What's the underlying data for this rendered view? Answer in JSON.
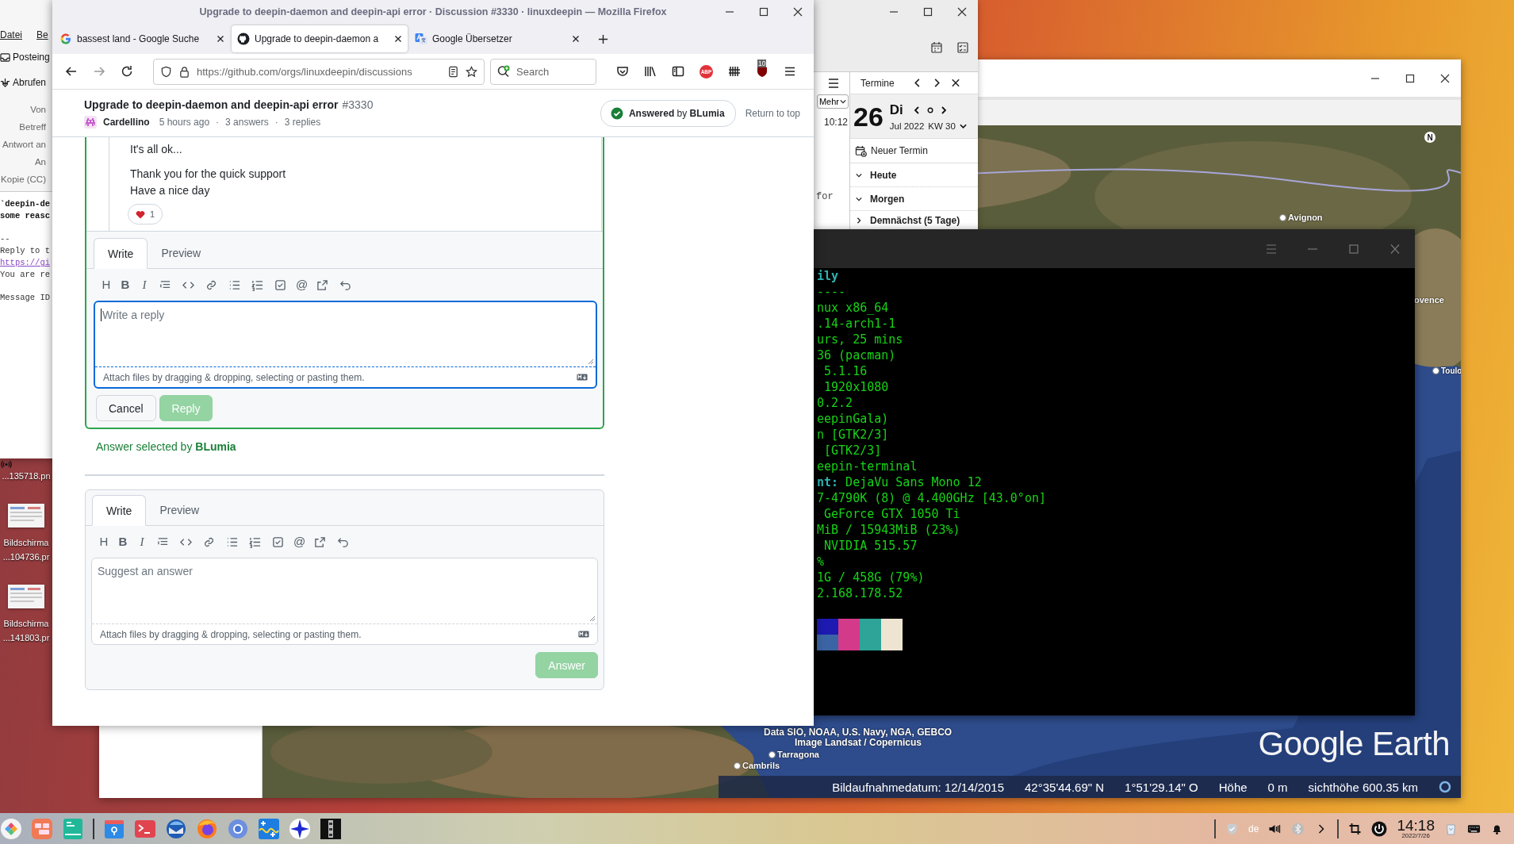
{
  "thunderbird": {
    "menu": [
      "Datei",
      "Be"
    ],
    "toolbar": [
      {
        "kind": "inbox",
        "label": "Posteing"
      },
      {
        "kind": "fetch",
        "label": "Abrufen"
      }
    ],
    "header_fields": [
      "Von",
      "Betreff",
      "Antwort an",
      "An",
      "Kopie (CC)"
    ],
    "body_paragraphs": [
      [
        {
          "kind": "bold",
          "text": "`deepin-de"
        },
        {
          "kind": "bold",
          "text": "some reasc"
        }
      ],
      [
        {
          "kind": "plain",
          "text": "--"
        },
        {
          "kind": "plain",
          "text": "Reply to t"
        },
        {
          "kind": "link",
          "text": "https://gi"
        },
        {
          "kind": "plain",
          "text": "You are re"
        }
      ],
      [
        {
          "kind": "plain",
          "text": "Message ID"
        }
      ]
    ],
    "view_select": "Mehr",
    "message_time": "10:12",
    "message_fragment": "for"
  },
  "today_pane": {
    "title": "Termine",
    "day": "26",
    "weekday": "Di",
    "month": "Jul 2022",
    "week": "KW 30",
    "new_event": "Neuer Termin",
    "groups": [
      {
        "label": "Heute",
        "expanded": true
      },
      {
        "label": "Morgen",
        "expanded": true
      },
      {
        "label": "Demnächst (5 Tage)",
        "expanded": false
      }
    ]
  },
  "firefox": {
    "title": "Upgrade to deepin-daemon and deepin-api error · Discussion #3330 · linuxdeepin — Mozilla Firefox",
    "tabs": [
      {
        "kind": "search",
        "label": "bassest land - Google Suche",
        "selected": false
      },
      {
        "kind": "code",
        "label": "Upgrade to deepin-daemon a",
        "selected": true
      },
      {
        "kind": "translate",
        "label": "Google Übersetzer",
        "selected": false
      }
    ],
    "url": "https://github.com/orgs/linuxdeepin/discussions",
    "search_placeholder": "Search",
    "adblock_label": "ABP",
    "blocker_badge": "10"
  },
  "discussion": {
    "title": "Upgrade to deepin-daemon and deepin-api error",
    "number": "#3330",
    "author": "Cardellino",
    "age": "5 hours ago",
    "answers": "3 answers",
    "replies": "3 replies",
    "separator": "·",
    "answered_by": "**Answered** by **BLumia**",
    "return_to_top": "Return to top",
    "comment_paragraphs": [
      [
        "It's all ok..."
      ],
      [
        "Thank you for the quick support",
        "Have a nice day"
      ]
    ],
    "reaction_count": "1",
    "reply_composer": {
      "tabs": [
        {
          "label": "Write",
          "selected": true
        },
        {
          "label": "Preview",
          "selected": false
        }
      ],
      "toolbar": [
        {
          "kind": "heading",
          "glyph": "H"
        },
        {
          "kind": "bold",
          "glyph": "B"
        },
        {
          "kind": "italic",
          "glyph": "I"
        },
        {
          "kind": "quote"
        },
        {
          "kind": "code"
        },
        {
          "kind": "link"
        },
        {
          "kind": "bullets"
        },
        {
          "kind": "numbers"
        },
        {
          "kind": "tasks"
        },
        {
          "kind": "mention",
          "glyph": "@"
        },
        {
          "kind": "reference"
        },
        {
          "kind": "undo"
        }
      ],
      "placeholder": "Write a reply",
      "focused": true,
      "attach_hint": "Attach files by dragging & dropping, selecting or pasting them.",
      "buttons": [
        {
          "kind": "secondary",
          "label": "Cancel",
          "disabled": false
        },
        {
          "kind": "primary",
          "label": "Reply",
          "disabled": true
        }
      ]
    },
    "answer_selected": "Answer selected by **BLumia**",
    "answer_composer": {
      "tabs": [
        {
          "label": "Write",
          "selected": true
        },
        {
          "label": "Preview",
          "selected": false
        }
      ],
      "toolbar": [
        {
          "kind": "heading",
          "glyph": "H"
        },
        {
          "kind": "bold",
          "glyph": "B"
        },
        {
          "kind": "italic",
          "glyph": "I"
        },
        {
          "kind": "quote"
        },
        {
          "kind": "code"
        },
        {
          "kind": "link"
        },
        {
          "kind": "bullets"
        },
        {
          "kind": "numbers"
        },
        {
          "kind": "tasks"
        },
        {
          "kind": "mention",
          "glyph": "@"
        },
        {
          "kind": "reference"
        },
        {
          "kind": "undo"
        }
      ],
      "placeholder": "Suggest an answer",
      "focused": false,
      "attach_hint": "Attach files by dragging & dropping, selecting or pasting them.",
      "buttons": [
        {
          "kind": "primary",
          "label": "Answer",
          "disabled": true
        }
      ]
    }
  },
  "terminal": {
    "lines": [
      {
        "kind": "title",
        "text": "ily"
      },
      {
        "kind": "plain",
        "text": "----"
      },
      {
        "kind": "plain",
        "text": "nux x86_64"
      },
      {
        "kind": "plain",
        "text": ".14-arch1-1"
      },
      {
        "kind": "plain",
        "text": "urs, 25 mins"
      },
      {
        "kind": "plain",
        "text": "36 (pacman)"
      },
      {
        "kind": "plain",
        "text": " 5.1.16"
      },
      {
        "kind": "plain",
        "text": " 1920x1080"
      },
      {
        "kind": "plain",
        "text": "0.2.2"
      },
      {
        "kind": "plain",
        "text": "eepinGala)"
      },
      {
        "kind": "plain",
        "text": "n [GTK2/3]"
      },
      {
        "kind": "plain",
        "text": " [GTK2/3]"
      },
      {
        "kind": "plain",
        "text": "eepin-terminal"
      },
      {
        "kind": "field",
        "key": "nt:",
        "text": " DejaVu Sans Mono 12"
      },
      {
        "kind": "plain",
        "text": "7-4790K (8) @ 4.400GHz [43.0°on]"
      },
      {
        "kind": "plain",
        "text": " GeForce GTX 1050 Ti"
      },
      {
        "kind": "plain",
        "text": "MiB / 15943MiB (23%)"
      },
      {
        "kind": "plain",
        "text": " NVIDIA 515.57"
      },
      {
        "kind": "plain",
        "text": "%"
      },
      {
        "kind": "plain",
        "text": "1G / 458G (79%)"
      },
      {
        "kind": "plain",
        "text": "2.168.178.52"
      }
    ],
    "palette": {
      "top": [
        {
          "color": "#1c1ab0"
        },
        {
          "color": "#d43a8a"
        },
        {
          "color": "#2ea398"
        },
        {
          "color": "#ede4d2"
        }
      ],
      "bottom": [
        {
          "color": "#3a64a4"
        },
        {
          "color": "#d43a8a"
        },
        {
          "color": "#2ea398"
        },
        {
          "color": "#ede4d2"
        }
      ]
    }
  },
  "earth": {
    "compass_label": "N",
    "place_labels": [
      {
        "text": "Avignon"
      },
      {
        "text": "ovence"
      },
      {
        "text": "Toulo"
      },
      {
        "text": "Tarragona"
      },
      {
        "text": "Cambrils"
      }
    ],
    "attribution": [
      "Data SIO, NOAA, U.S. Navy, NGA, GEBCO",
      "Image Landsat / Copernicus"
    ],
    "logo": "Google Earth",
    "status": {
      "date": "Bildaufnahmedatum: 12/14/2015",
      "latitude": "42°35'44.69\" N",
      "longitude": "1°51'29.14\" O",
      "elevation_label": "Höhe",
      "elevation": "0 m",
      "eye_altitude": "sichthöhe 600.35 km"
    }
  },
  "desktop": {
    "files": [
      {
        "kind": "label_only",
        "lines": [
          "...135718.pn"
        ]
      },
      {
        "kind": "screenshot",
        "lines": [
          "Bildschirma",
          "...104736.pr"
        ]
      },
      {
        "kind": "screenshot",
        "lines": [
          "Bildschirma",
          "...141803.pr"
        ]
      }
    ]
  },
  "taskbar": {
    "system": [
      {
        "kind": "launcher"
      },
      {
        "kind": "multitask"
      },
      {
        "kind": "editor"
      }
    ],
    "apps": [
      {
        "kind": "files"
      },
      {
        "kind": "terminal"
      },
      {
        "kind": "mail"
      },
      {
        "kind": "browser-fire"
      },
      {
        "kind": "browser-ring"
      },
      {
        "kind": "plot"
      },
      {
        "kind": "compass"
      },
      {
        "kind": "dark"
      }
    ],
    "keyboard_layout": "de",
    "time": "14:18",
    "date": "2022/7/26"
  }
}
